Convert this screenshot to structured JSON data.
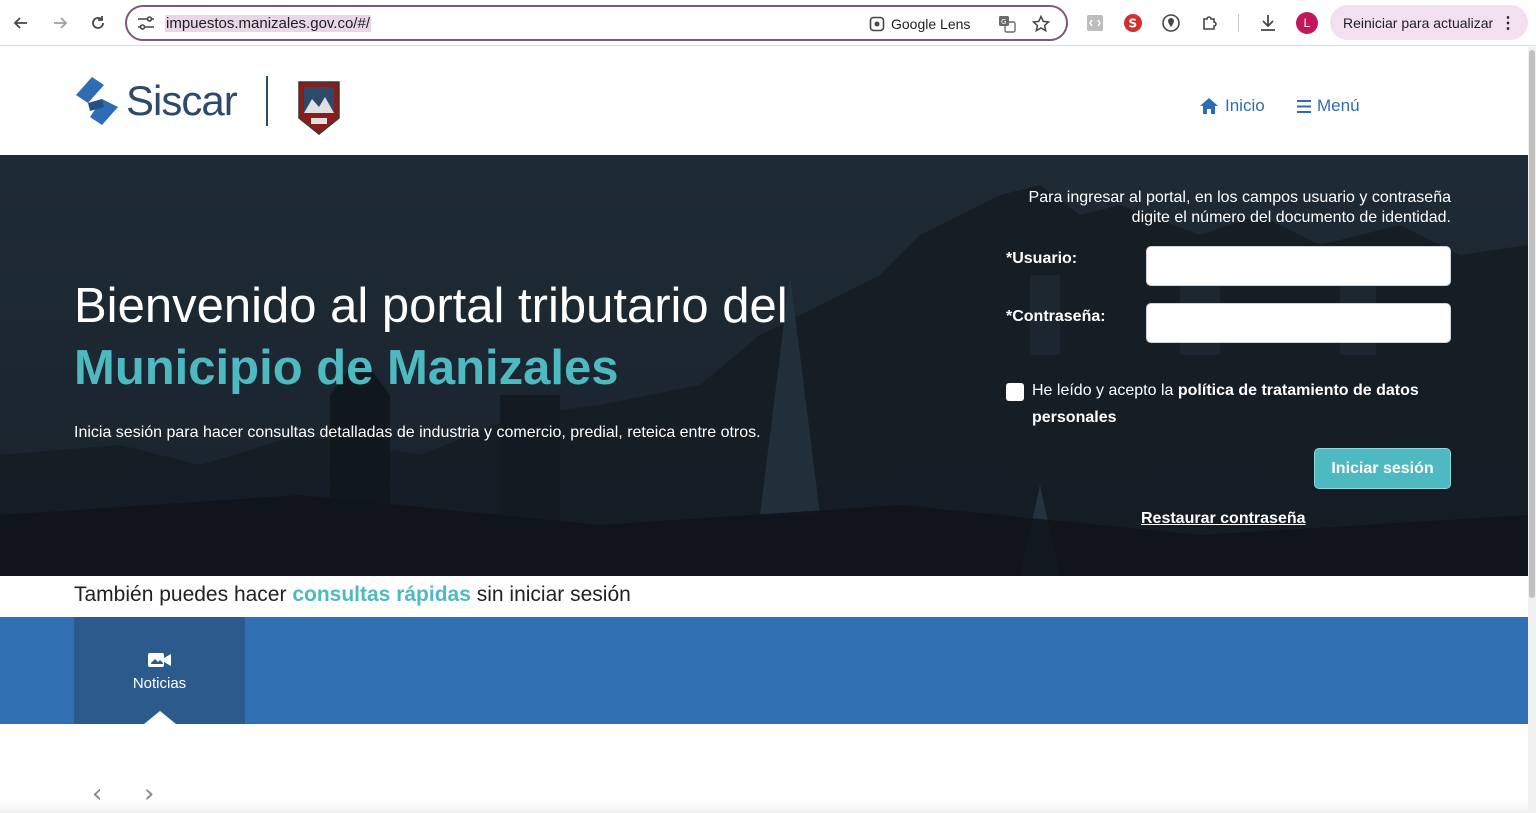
{
  "browser": {
    "url_text": "impuestos.manizales.gov.co/#/",
    "lens_label": "Google Lens",
    "profile_initial": "L",
    "update_label": "Reiniciar para actualizar",
    "profile_color": "#c2185b"
  },
  "header": {
    "brand": "Siscar",
    "nav": [
      {
        "label": "Inicio",
        "icon": "home-icon"
      },
      {
        "label": "Menú",
        "icon": "hamburger-icon"
      }
    ]
  },
  "hero": {
    "title_line1": "Bienvenido al portal tributario del",
    "title_line2": "Municipio de Manizales",
    "subtitle": "Inicia sesión para hacer consultas detalladas de industria y comercio, predial, reteica entre otros."
  },
  "login": {
    "instructions": "Para ingresar al portal, en los campos usuario y contraseña digite el número del documento de identidad.",
    "user_label": "*Usuario:",
    "user_value": "",
    "password_label": "*Contraseña:",
    "password_value": "",
    "consent_prefix": "He leído y acepto la",
    "consent_link": "política de tratamiento de datos personales",
    "submit_label": "Iniciar sesión",
    "restore_label": "Restaurar contraseña"
  },
  "quick": {
    "prefix": "También puedes hacer",
    "accent": "consultas rápidas",
    "suffix": "sin iniciar sesión",
    "tabs": [
      {
        "label": "Noticias",
        "icon": "video-camera-icon"
      }
    ]
  },
  "carousel": {
    "prev": "‹",
    "next": "›"
  },
  "colors": {
    "accent": "#4fb9c1",
    "brand_blue": "#2e6db4",
    "band": "#3170b2",
    "hero_bg": "#1e2a34"
  }
}
